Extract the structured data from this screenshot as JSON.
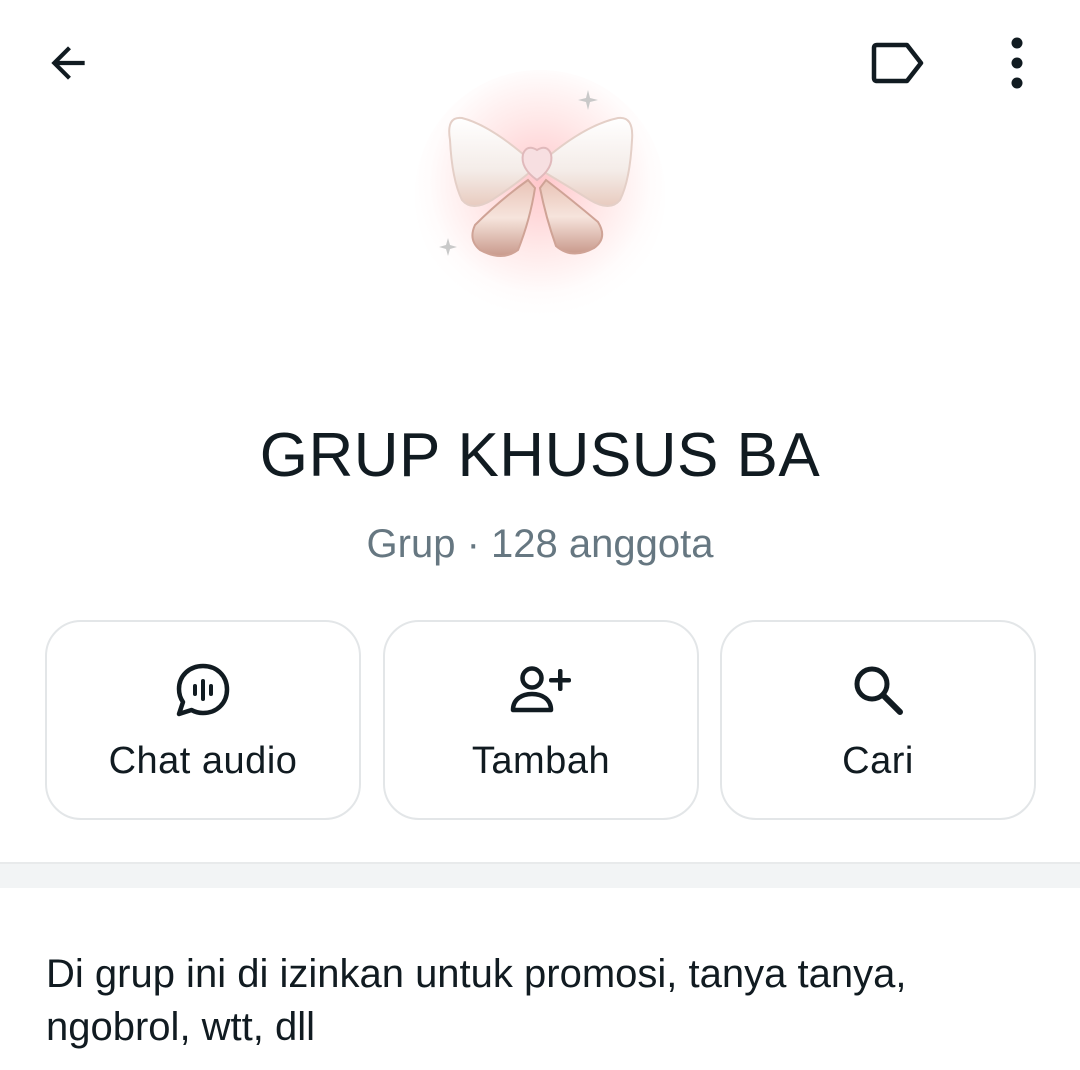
{
  "header": {
    "back_icon": "arrow-left-icon",
    "label_icon": "label-tag-icon",
    "more_icon": "more-vertical-icon"
  },
  "group": {
    "avatar_icon": "pink-bow-avatar",
    "name": "GRUP KHUSUS BA",
    "subtitle": "Grup · 128 anggota"
  },
  "actions": [
    {
      "label": "Chat audio",
      "icon": "audio-chat-icon"
    },
    {
      "label": "Tambah",
      "icon": "add-person-icon"
    },
    {
      "label": "Cari",
      "icon": "search-icon"
    }
  ],
  "description": {
    "text": "Di grup ini di izinkan untuk promosi, tanya tanya, ngobrol, wtt, dll"
  },
  "colors": {
    "primary_text": "#111b21",
    "secondary_text": "#667781",
    "card_border": "#e3e6e8",
    "divider": "#f2f4f5"
  }
}
